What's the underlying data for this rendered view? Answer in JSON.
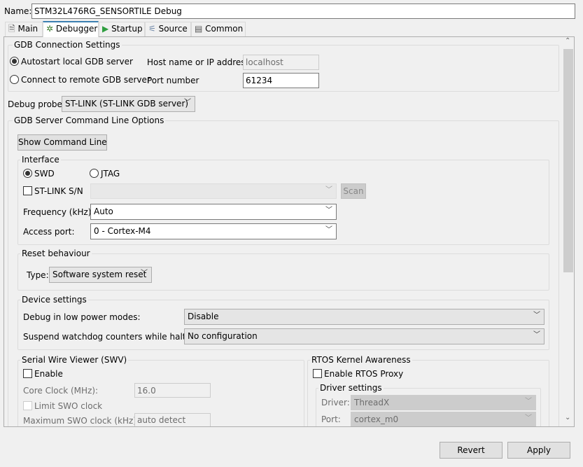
{
  "name_label": "Name:",
  "name_value": "STM32L476RG_SENSORTILE Debug",
  "tabs": [
    {
      "label": "Main"
    },
    {
      "label": "Debugger"
    },
    {
      "label": "Startup"
    },
    {
      "label": "Source"
    },
    {
      "label": "Common"
    }
  ],
  "gdb": {
    "title": "GDB Connection Settings",
    "autostart": "Autostart local GDB server",
    "remote": "Connect to remote GDB server",
    "host_label": "Host name or IP address",
    "host_value": "localhost",
    "port_label": "Port number",
    "port_value": "61234"
  },
  "probe": {
    "label": "Debug probe",
    "value": "ST-LINK (ST-LINK GDB server)"
  },
  "server": {
    "title": "GDB Server Command Line Options",
    "show_cmd": "Show Command Line"
  },
  "interface": {
    "title": "Interface",
    "swd": "SWD",
    "jtag": "JTAG",
    "sn_label": "ST-LINK S/N",
    "scan": "Scan",
    "freq_label": "Frequency (kHz):",
    "freq_value": "Auto",
    "ap_label": "Access port:",
    "ap_value": "0 - Cortex-M4"
  },
  "reset": {
    "title": "Reset behaviour",
    "type_label": "Type:",
    "type_value": "Software system reset"
  },
  "device": {
    "title": "Device settings",
    "lowpower_label": "Debug in low power modes:",
    "lowpower_value": "Disable",
    "watchdog_label": "Suspend watchdog counters while halted:",
    "watchdog_value": "No configuration"
  },
  "swv": {
    "title": "Serial Wire Viewer (SWV)",
    "enable": "Enable",
    "core_label": "Core Clock (MHz):",
    "core_value": "16.0",
    "limit": "Limit SWO clock",
    "max_label": "Maximum SWO clock (kHz):",
    "max_value": "auto detect"
  },
  "rtos": {
    "title": "RTOS Kernel Awareness",
    "enable": "Enable RTOS Proxy",
    "driver_title": "Driver settings",
    "driver_label": "Driver:",
    "driver_value": "ThreadX",
    "port_label": "Port:",
    "port_value": "cortex_m0"
  },
  "buttons": {
    "revert": "Revert",
    "apply": "Apply"
  }
}
